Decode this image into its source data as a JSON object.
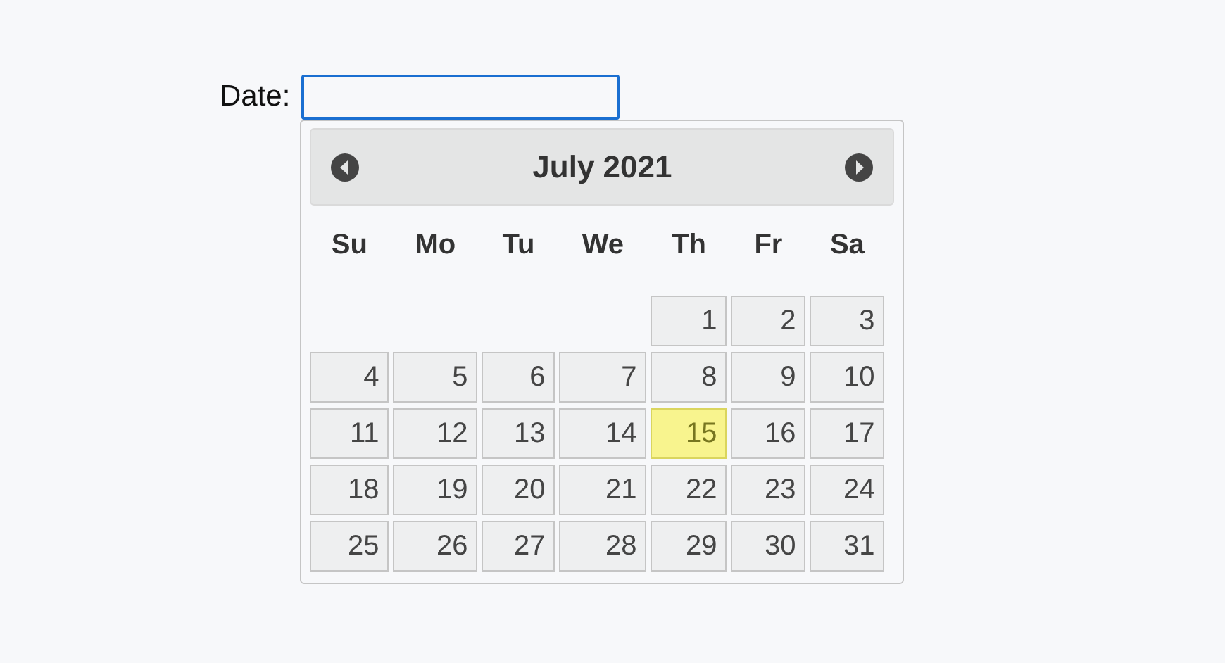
{
  "field": {
    "label": "Date:"
  },
  "calendar": {
    "title": "July 2021",
    "weekdays": [
      "Su",
      "Mo",
      "Tu",
      "We",
      "Th",
      "Fr",
      "Sa"
    ],
    "weeks": [
      [
        {
          "day": "1",
          "today": false
        },
        {
          "day": "2",
          "today": false
        },
        {
          "day": "3",
          "today": false
        }
      ],
      [
        {
          "day": "4",
          "today": false
        },
        {
          "day": "5",
          "today": false
        },
        {
          "day": "6",
          "today": false
        },
        {
          "day": "7",
          "today": false
        },
        {
          "day": "8",
          "today": false
        },
        {
          "day": "9",
          "today": false
        },
        {
          "day": "10",
          "today": false
        }
      ],
      [
        {
          "day": "11",
          "today": false
        },
        {
          "day": "12",
          "today": false
        },
        {
          "day": "13",
          "today": false
        },
        {
          "day": "14",
          "today": false
        },
        {
          "day": "15",
          "today": true
        },
        {
          "day": "16",
          "today": false
        },
        {
          "day": "17",
          "today": false
        }
      ],
      [
        {
          "day": "18",
          "today": false
        },
        {
          "day": "19",
          "today": false
        },
        {
          "day": "20",
          "today": false
        },
        {
          "day": "21",
          "today": false
        },
        {
          "day": "22",
          "today": false
        },
        {
          "day": "23",
          "today": false
        },
        {
          "day": "24",
          "today": false
        }
      ],
      [
        {
          "day": "25",
          "today": false
        },
        {
          "day": "26",
          "today": false
        },
        {
          "day": "27",
          "today": false
        },
        {
          "day": "28",
          "today": false
        },
        {
          "day": "29",
          "today": false
        },
        {
          "day": "30",
          "today": false
        },
        {
          "day": "31",
          "today": false
        }
      ]
    ]
  }
}
